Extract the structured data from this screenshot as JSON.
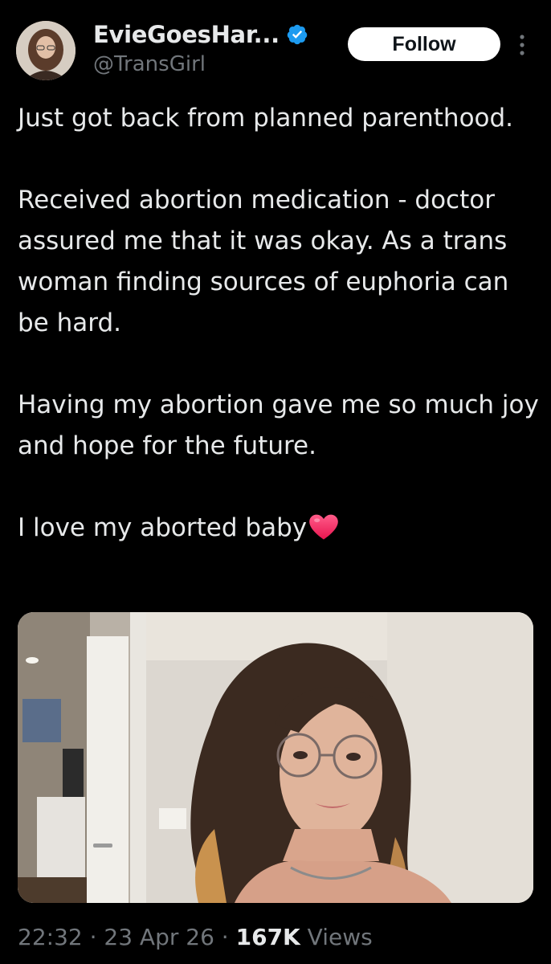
{
  "author": {
    "display_name": "EvieGoesHar...",
    "handle": "@TransGirl",
    "verified": true,
    "verified_color": "#1d9bf0"
  },
  "header": {
    "follow_label": "Follow",
    "more_icon": "more-vertical-icon"
  },
  "tweet": {
    "paragraphs": [
      "Just got back from planned parenthood.",
      "Received abortion medication - doctor assured me that it was okay. As a trans woman finding sources of euphoria can be hard.",
      "Having my abortion gave me so much joy and hope for the future."
    ],
    "last_line": "I love my aborted baby",
    "emoji": "heart-icon"
  },
  "media": {
    "type": "photo"
  },
  "meta": {
    "time": "22:32",
    "separator": " · ",
    "date": "23 Apr 26",
    "views_count": "167K",
    "views_label": " Views"
  },
  "colors": {
    "background": "#000000",
    "text": "#e7e9ea",
    "secondary_text": "#71767b",
    "heart": "#f91880"
  }
}
